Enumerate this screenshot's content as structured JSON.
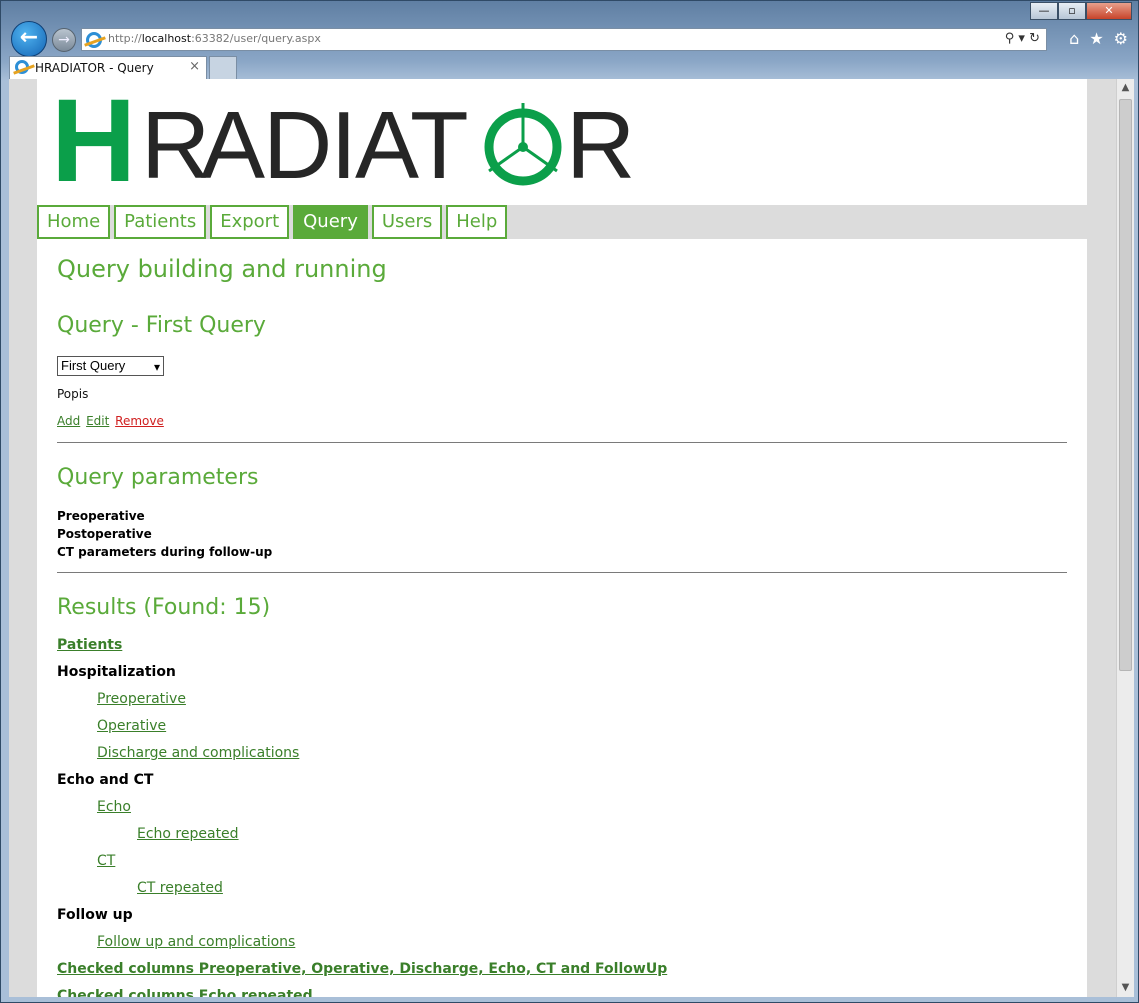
{
  "browser": {
    "url_prefix": "http://",
    "url_host": "localhost",
    "url_rest": ":63382/user/query.aspx",
    "tab_title": "HRADIATOR - Query",
    "tab_close": "×",
    "icons": [
      "back-arrow-icon",
      "forward-arrow-icon",
      "ie-icon",
      "search-icon",
      "refresh-icon",
      "home-icon",
      "favorites-star-icon",
      "gear-icon"
    ],
    "window_controls": {
      "minimize": "—",
      "maximize": "▫",
      "close": "✕"
    }
  },
  "logo": {
    "hr_h": "H",
    "hr_r": "R",
    "word": "ADIAT",
    "tail": "R"
  },
  "menu": [
    {
      "label": "Home",
      "active": false
    },
    {
      "label": "Patients",
      "active": false
    },
    {
      "label": "Export",
      "active": false
    },
    {
      "label": "Query",
      "active": true
    },
    {
      "label": "Users",
      "active": false
    },
    {
      "label": "Help",
      "active": false
    }
  ],
  "main": {
    "title": "Query building and running",
    "query_title": "Query - First Query",
    "query_select": "First Query",
    "description": "Popis",
    "actions": {
      "add": "Add",
      "edit": "Edit",
      "remove": "Remove"
    },
    "params_title": "Query parameters",
    "params": [
      "Preoperative",
      "Postoperative",
      "CT parameters during follow-up"
    ],
    "results_title": "Results (Found: 15)",
    "results": {
      "patients": "Patients",
      "hospitalization": "Hospitalization",
      "preoperative": "Preoperative",
      "operative": "Operative",
      "discharge": "Discharge and complications",
      "echo_ct": "Echo and CT",
      "echo": "Echo",
      "echo_repeated": "Echo repeated",
      "ct": "CT",
      "ct_repeated": "CT repeated",
      "follow_up": "Follow up",
      "follow_up_compl": "Follow up and complications",
      "checked_1": "Checked columns Preoperative, Operative, Discharge, Echo, CT and FollowUp",
      "checked_2": "Checked columns Echo repeated"
    }
  },
  "colors": {
    "accent": "#5aaa3a",
    "link": "#3a7f2a",
    "remove": "#d02020",
    "logo_green": "#0b9f4a"
  }
}
